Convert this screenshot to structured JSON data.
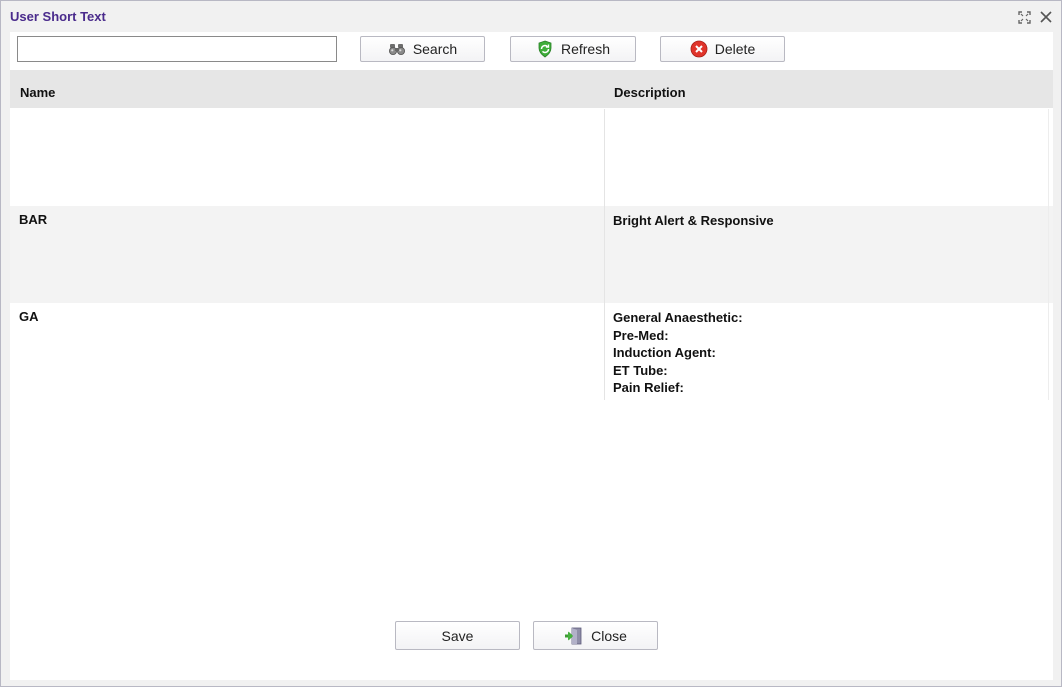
{
  "window": {
    "title": "User Short Text"
  },
  "toolbar": {
    "search_value": "",
    "search_label": "Search",
    "refresh_label": "Refresh",
    "delete_label": "Delete"
  },
  "grid": {
    "columns": [
      "Name",
      "Description"
    ],
    "rows": [
      {
        "name": "",
        "description": []
      },
      {
        "name": "BAR",
        "description": [
          "Bright Alert & Responsive"
        ]
      },
      {
        "name": "GA",
        "description": [
          "General Anaesthetic:",
          "Pre-Med:",
          "Induction Agent:",
          "ET Tube:",
          "Pain Relief:"
        ]
      }
    ]
  },
  "footer": {
    "save_label": "Save",
    "close_label": "Close"
  },
  "colors": {
    "title": "#4a2b8c",
    "header_bg": "#e6e6e6",
    "alt_row_bg": "#f3f3f3"
  },
  "icons": {
    "search": "binoculars-icon",
    "refresh": "refresh-shield-icon",
    "delete": "delete-x-icon",
    "close": "exit-door-icon",
    "maximize": "maximize-icon",
    "window_close": "close-icon"
  }
}
